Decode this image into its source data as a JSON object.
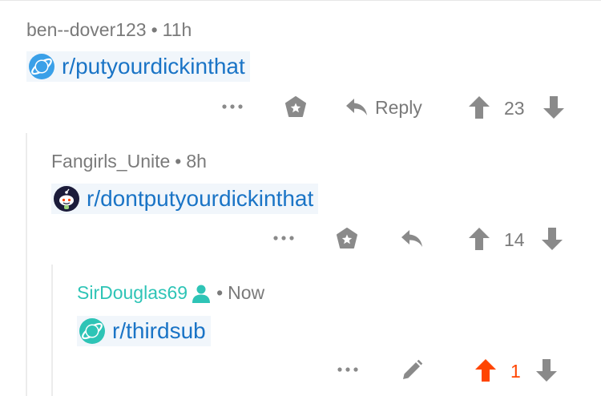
{
  "comments": [
    {
      "author": "ben--dover123",
      "separator": "•",
      "time": "11h",
      "subreddit": "r/putyourdickinthat",
      "subreddit_icon": "planet-icon",
      "reply_label": "Reply",
      "score": "23"
    },
    {
      "author": "Fangirls_Unite",
      "separator": "•",
      "time": "8h",
      "subreddit": "r/dontputyourdickinthat",
      "subreddit_icon": "snoo-icon",
      "score": "14"
    },
    {
      "author": "SirDouglas69",
      "author_badge_icon": "op-person-icon",
      "separator": "•",
      "time": "Now",
      "subreddit": "r/thirdsub",
      "subreddit_icon": "planet-icon",
      "score": "1",
      "score_state": "upvoted"
    }
  ],
  "colors": {
    "link": "#1a74c6",
    "meta_text": "#7a7a7a",
    "op_author": "#2ec4b6",
    "upvote_active": "#ff4500",
    "icon_gray": "#8a8a8a"
  }
}
